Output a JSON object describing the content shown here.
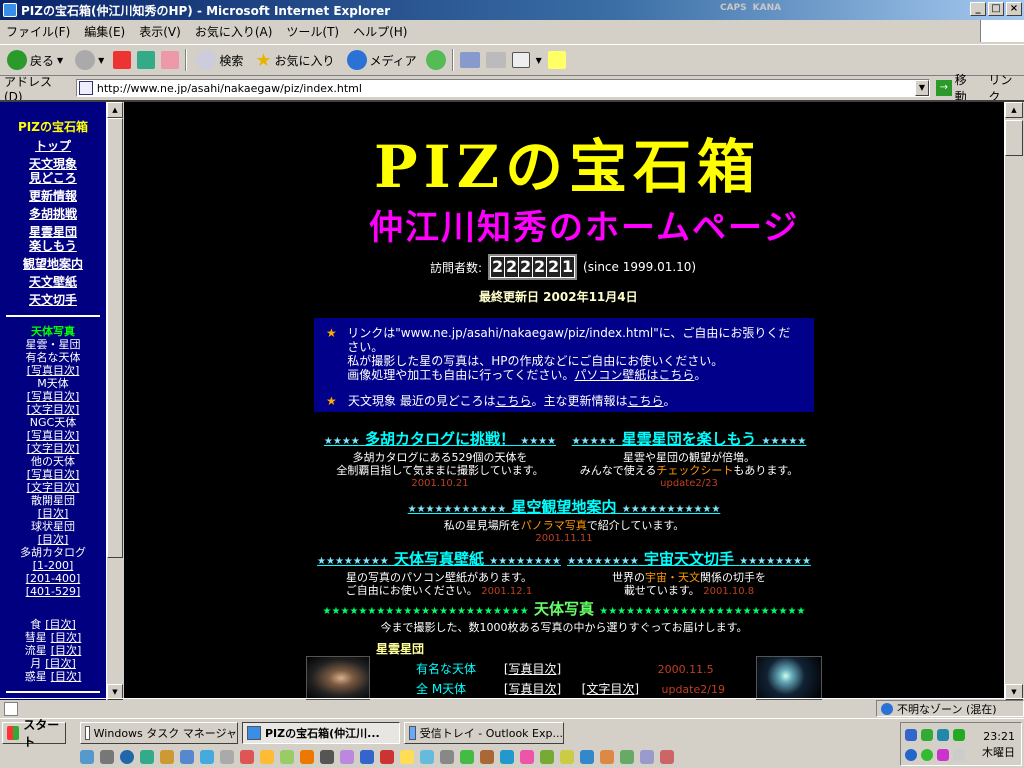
{
  "window": {
    "title": "PIZの宝石箱(仲江川知秀のHP) - Microsoft Internet Explorer",
    "min": "_",
    "max": "□",
    "close": "×"
  },
  "ghost_tray": [
    "CAPS",
    "KANA"
  ],
  "menu": [
    "ファイル(F)",
    "編集(E)",
    "表示(V)",
    "お気に入り(A)",
    "ツール(T)",
    "ヘルプ(H)"
  ],
  "toolbar": {
    "back": "戻る",
    "search": "検索",
    "favorites": "お気に入り",
    "media": "メディア"
  },
  "address": {
    "label": "アドレス(D)",
    "url": "http://www.ne.jp/asahi/nakaegaw/piz/index.html",
    "go": "移動",
    "links": "リンク"
  },
  "nav": {
    "title": "PIZの宝石箱",
    "links": [
      "トップ",
      "天文現象\n見どころ",
      "更新情報",
      "多胡挑戦",
      "星雲星団\n楽しもう",
      "観望地案内",
      "天文壁紙",
      "天文切手"
    ],
    "photo_title": "天体写真",
    "photo_items": [
      {
        "t": "text",
        "v": "星雲・星団"
      },
      {
        "t": "text",
        "v": "有名な天体"
      },
      {
        "t": "link",
        "v": "[写真目次]"
      },
      {
        "t": "text",
        "v": "M天体"
      },
      {
        "t": "link",
        "v": "[写真目次]"
      },
      {
        "t": "link",
        "v": "[文字目次]"
      },
      {
        "t": "text",
        "v": "NGC天体"
      },
      {
        "t": "link",
        "v": "[写真目次]"
      },
      {
        "t": "link",
        "v": "[文字目次]"
      },
      {
        "t": "text",
        "v": "他の天体"
      },
      {
        "t": "link",
        "v": "[写真目次]"
      },
      {
        "t": "link",
        "v": "[文字目次]"
      },
      {
        "t": "text",
        "v": "散開星団"
      },
      {
        "t": "link",
        "v": "[目次]"
      },
      {
        "t": "text",
        "v": "球状星団"
      },
      {
        "t": "link",
        "v": "[目次]"
      },
      {
        "t": "text",
        "v": "多胡カタログ"
      },
      {
        "t": "link",
        "v": "[1-200]"
      },
      {
        "t": "link",
        "v": "[201-400]"
      },
      {
        "t": "link",
        "v": "[401-529]"
      }
    ],
    "mini": [
      [
        "食",
        "[目次]"
      ],
      [
        "彗星",
        "[目次]"
      ],
      [
        "流星",
        "[目次]"
      ],
      [
        "月",
        "[目次]"
      ],
      [
        "惑星",
        "[目次]"
      ]
    ]
  },
  "header": {
    "logo_main": "PIZの宝石箱",
    "logo_sub": "仲江川知秀のホームページ"
  },
  "visitor": {
    "label": "訪問者数:",
    "digits": [
      "2",
      "2",
      "2",
      "2",
      "2",
      "1"
    ],
    "since": "(since 1999.01.10)"
  },
  "last_update": "最終更新日 2002年11月4日",
  "info": {
    "star": "★",
    "line1a": "リンクは\"www.ne.jp/asahi/nakaegaw/piz/index.html\"に、ご自由にお張りください。",
    "line1b": "私が撮影した星の写真は、HPの作成などにご自由にお使いください。",
    "line1c_pre": "画像処理や加工も自由に行ってください。",
    "line1c_link": "パソコン壁紙はこちら",
    "line1c_post": "。",
    "line2_pre": "天文現象 最近の見どころは",
    "line2_link1": "こちら",
    "line2_mid": "。主な更新情報は",
    "line2_link2": "こちら",
    "line2_post": "。"
  },
  "sections": {
    "tago": {
      "stars": "★★★★",
      "title": "多胡カタログに挑戦！",
      "d1": "多胡カタログにある529個の天体を",
      "d2": "全制覇目指して気ままに撮影しています。",
      "date": "2001.10.21"
    },
    "nebula": {
      "stars": "★★★★★",
      "title": "星雲星団を楽しもう",
      "d1": "星雲や星団の観望が倍増。",
      "d2_pre": "みんなで使える",
      "d2_hl": "チェックシート",
      "d2_post": "もあります。",
      "date": "update2/23"
    },
    "site": {
      "stars": "★★★★★★★★★★★",
      "title": "星空観望地案内",
      "d1_pre": "私の星見場所を",
      "d1_hl": "パノラマ写真",
      "d1_post": "で紹介しています。",
      "date": "2001.11.11"
    },
    "wall": {
      "stars": "★★★★★★★★",
      "title": "天体写真壁紙",
      "d1": "星の写真のパソコン壁紙があります。",
      "d2": "ご自由にお使いください。",
      "date": "2001.12.1"
    },
    "stamp": {
      "stars": "★★★★★★★★",
      "title": "宇宙天文切手",
      "d1_pre": "世界の",
      "d1_hl": "宇宙・天文",
      "d1_post": "関係の切手を",
      "d2": "載せています。",
      "date": "2001.10.8"
    },
    "photo": {
      "stars": "★★★★★★★★★★★★★★★★★★★★★★★",
      "title": "天体写真",
      "d1": "今まで撮影した、数1000枚ある写真の中から選りすぐってお届けします。"
    }
  },
  "nebulas_label": "星雲星団",
  "table": [
    {
      "name": "有名な天体",
      "l1": "[写真目次]",
      "l2": "",
      "date": "2000.11.5"
    },
    {
      "name": "全 M天体",
      "l1": "[写真目次]",
      "l2": "[文字目次]",
      "date": "update2/19"
    }
  ],
  "status": {
    "zone": "不明なゾーン (混在)"
  },
  "taskbar": {
    "start": "スタート",
    "tasks": [
      "Windows タスク マネージャ",
      "PIZの宝石箱(仲江川...",
      "受信トレイ - Outlook Exp..."
    ],
    "time": "23:21",
    "day": "木曜日"
  },
  "colors": {
    "nav_bg": "#000080",
    "info_bg": "#00008b",
    "logo_main": "#ffff00",
    "logo_sub": "#ff00ff",
    "section_title": "#00ffff"
  }
}
